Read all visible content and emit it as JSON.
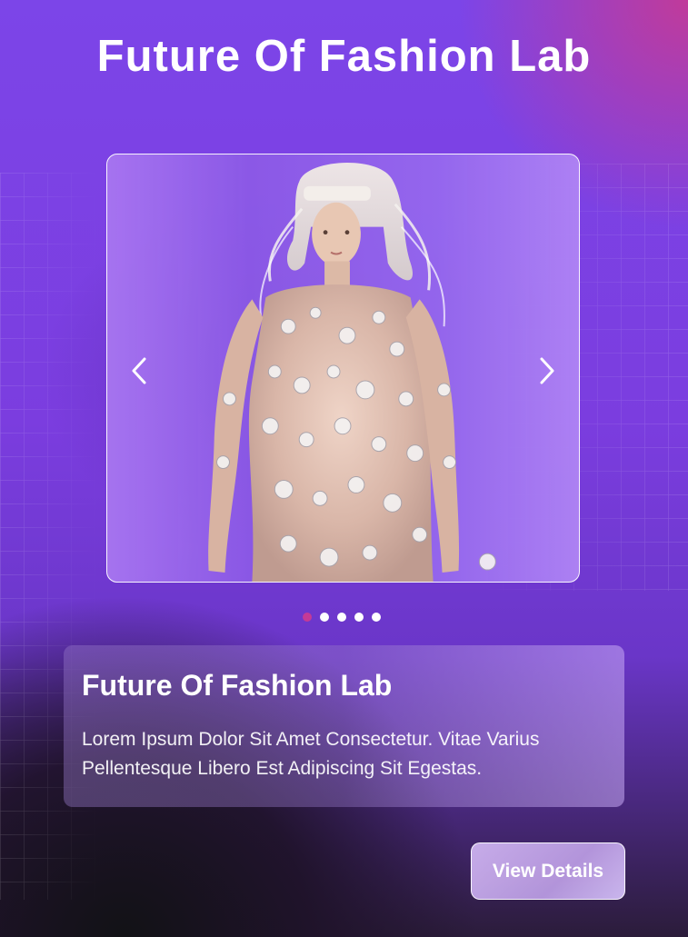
{
  "header": {
    "title": "Future Of Fashion Lab"
  },
  "carousel": {
    "prev_icon": "chevron-left-icon",
    "next_icon": "chevron-right-icon",
    "slide_count": 5,
    "active_index": 0
  },
  "info": {
    "title": "Future Of Fashion Lab",
    "description": "Lorem Ipsum Dolor Sit Amet Consectetur. Vitae Varius Pellentesque Libero Est Adipiscing Sit Egestas."
  },
  "actions": {
    "view_details_label": "View Details"
  },
  "colors": {
    "accent": "#c43a96",
    "background": "#7d41e4",
    "text": "#ffffff"
  }
}
